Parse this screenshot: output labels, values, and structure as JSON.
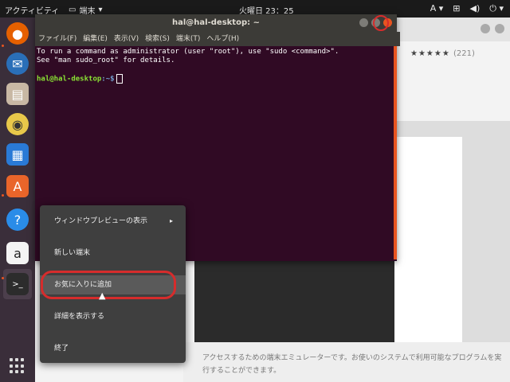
{
  "topbar": {
    "activities": "アクティビティ",
    "app_name": "端末",
    "clock": "火曜日 23：25",
    "input_method": "A",
    "icons": [
      "network-icon",
      "volume-icon",
      "power-icon"
    ]
  },
  "dock": {
    "items": [
      "firefox-icon",
      "thunderbird-icon",
      "files-icon",
      "rhythmbox-icon",
      "libreoffice-writer-icon",
      "software-icon",
      "help-icon",
      "amazon-icon",
      "terminal-icon"
    ],
    "show_apps_icon": "show-apps-icon"
  },
  "software": {
    "stars": "★★★★★",
    "count": "(221)",
    "description": "アクセスするための端末エミュレーターです。お使いのシステムで利用可能なプログラムを実行することができます。"
  },
  "terminal": {
    "title": "hal@hal-desktop: ~",
    "menu": [
      "ファイル(F)",
      "編集(E)",
      "表示(V)",
      "検索(S)",
      "端末(T)",
      "ヘルプ(H)"
    ],
    "line1": "To run a command as administrator (user \"root\"), use \"sudo <command>\".",
    "line2": "See \"man sudo_root\" for details.",
    "prompt_user": "hal@hal-desktop",
    "prompt_path": ":~$"
  },
  "context_menu": {
    "items": [
      {
        "label": "ウィンドウプレビューの表示",
        "submenu": "▸"
      },
      {
        "label": "新しい端末"
      },
      {
        "label": "お気に入りに追加"
      },
      {
        "label": "詳細を表示する"
      },
      {
        "label": "終了"
      }
    ]
  },
  "colors": {
    "terminal_bg": "#300a24",
    "accent": "#e95420",
    "highlight_ring": "#d62c2c"
  }
}
